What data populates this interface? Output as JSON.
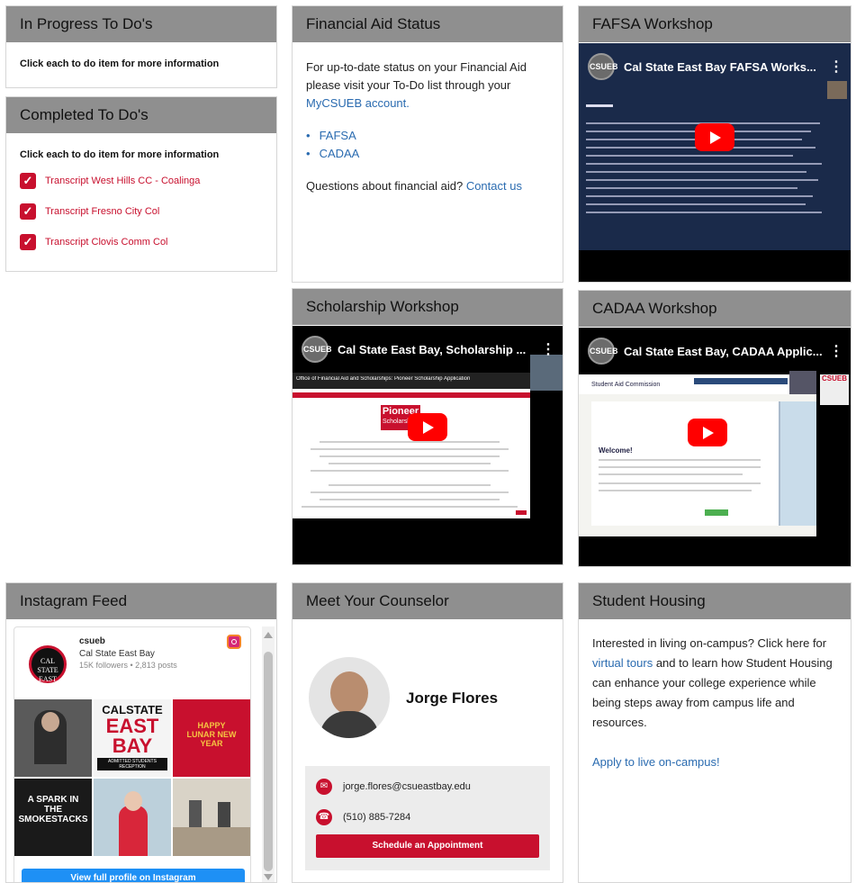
{
  "in_progress": {
    "title": "In Progress To Do's",
    "hint": "Click each to do item for more information"
  },
  "completed": {
    "title": "Completed To Do's",
    "hint": "Click each to do item for more information",
    "items": [
      {
        "label": "Transcript West Hills CC - Coalinga"
      },
      {
        "label": "Transcript Fresno City Col"
      },
      {
        "label": "Transcript Clovis Comm Col"
      }
    ]
  },
  "financial_aid": {
    "title": "Financial Aid Status",
    "text_1": "For up-to-date status on your Financial Aid please visit your To-Do list through your",
    "account_link": "MyCSUEB account.",
    "links": [
      "FAFSA",
      "CADAA"
    ],
    "questions_text": "Questions about financial aid?",
    "contact_link": "Contact us"
  },
  "fafsa_workshop": {
    "title": "FAFSA Workshop",
    "video_title": "Cal State East Bay FAFSA Works...",
    "channel_logo": "CSUEB"
  },
  "scholarship_workshop": {
    "title": "Scholarship Workshop",
    "video_title": "Cal State East Bay, Scholarship ...",
    "banner": "Office of Financial Aid and Scholarships: Pioneer Scholarship Application",
    "logo_text": "Pioneer",
    "logo_sub": "Scholarships",
    "channel_logo": "CSUEB"
  },
  "cadaa_workshop": {
    "title": "CADAA Workshop",
    "video_title": "Cal State East Bay, CADAA Applic...",
    "site_name": "Student Aid Commission",
    "welcome": "Welcome!",
    "channel_logo": "CSUEB"
  },
  "instagram": {
    "title": "Instagram Feed",
    "handle": "csueb",
    "name": "Cal State East Bay",
    "stats": "15K followers • 2,813 posts",
    "avatar_text": "CAL STATE EAST BAY",
    "tile_cal": "CALSTATE",
    "tile_east": "EAST",
    "tile_bay": "BAY",
    "tile_reception": "ADMITTED STUDENTS RECEPTION",
    "tile_lunar": "HAPPY LUNAR NEW YEAR",
    "tile_spark": "A SPARK IN THE SMOKESTACKS",
    "button": "View full profile on Instagram"
  },
  "counselor": {
    "title": "Meet Your Counselor",
    "name": "Jorge Flores",
    "email": "jorge.flores@csueastbay.edu",
    "phone": "(510) 885-7284",
    "button": "Schedule an Appointment"
  },
  "housing": {
    "title": "Student Housing",
    "text_1": "Interested in living on-campus? Click here for",
    "tours_link": "virtual tours",
    "text_2": "and to learn how Student Housing can enhance your college experience while being steps away from campus life and resources.",
    "apply_link": "Apply to live on-campus!"
  },
  "colors": {
    "header_bg": "#8f8f8f",
    "brand_red": "#c8102e",
    "link_blue": "#2a6bb0",
    "instagram_blue": "#1e90f5"
  }
}
